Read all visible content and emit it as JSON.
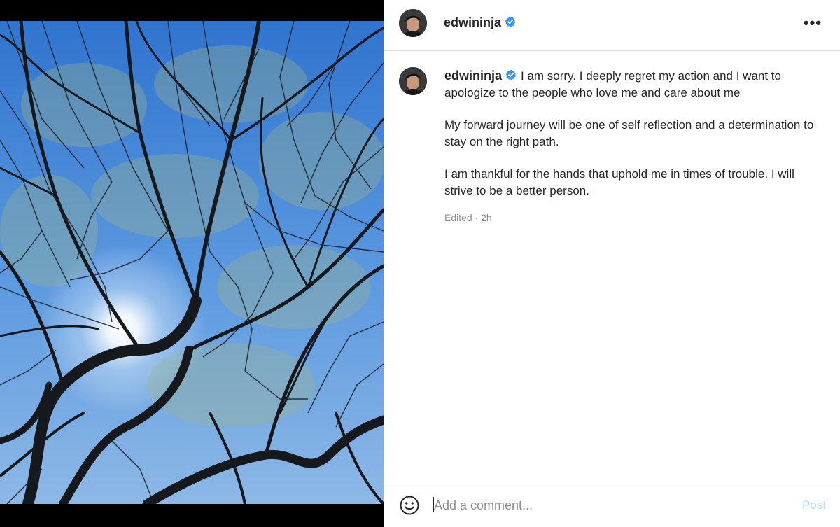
{
  "post": {
    "username": "edwininja",
    "verified": true,
    "more_label": "•••"
  },
  "caption": {
    "username": "edwininja",
    "paragraphs": [
      "I am sorry. I deeply regret my action and I want to apologize to the people who love me and care about me",
      "My forward journey will be one of self reflection and a determination to stay on the right path.",
      "I am thankful for the hands that uphold me in times of trouble. I will strive to be a better person."
    ],
    "meta": "Edited · 2h"
  },
  "comment": {
    "placeholder": "Add a comment...",
    "post_label": "Post"
  },
  "colors": {
    "verified_blue": "#3897f0",
    "post_disabled": "#b8dcf5",
    "sky_top": "#3f83d8",
    "sky_bottom": "#8fbde8"
  },
  "icons": {
    "verified": "verified-badge-icon",
    "more": "more-options-icon",
    "emoji": "emoji-smiley-icon"
  }
}
